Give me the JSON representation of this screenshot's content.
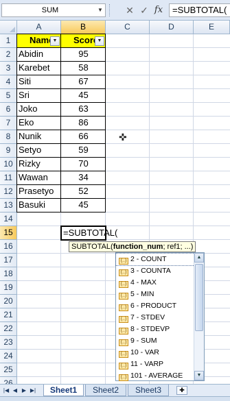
{
  "formula_bar": {
    "name_box": "SUM",
    "cancel_symbol": "✕",
    "enter_symbol": "✓",
    "fx_label": "fx",
    "formula": "=SUBTOTAL("
  },
  "columns": [
    "A",
    "B",
    "C",
    "D",
    "E"
  ],
  "rows": [
    "1",
    "2",
    "3",
    "4",
    "5",
    "6",
    "7",
    "8",
    "9",
    "10",
    "11",
    "12",
    "13",
    "14",
    "15",
    "16",
    "17",
    "18",
    "19",
    "20",
    "21",
    "22",
    "23",
    "24",
    "25",
    "26"
  ],
  "table": {
    "headers": [
      "Name",
      "Score"
    ],
    "rows": [
      [
        "Abidin",
        "95"
      ],
      [
        "Karebet",
        "58"
      ],
      [
        "Siti",
        "67"
      ],
      [
        "Sri",
        "45"
      ],
      [
        "Joko",
        "63"
      ],
      [
        "Eko",
        "86"
      ],
      [
        "Nunik",
        "66"
      ],
      [
        "Setyo",
        "59"
      ],
      [
        "Rizky",
        "70"
      ],
      [
        "Wawan",
        "34"
      ],
      [
        "Prasetyo",
        "52"
      ],
      [
        "Basuki",
        "45"
      ]
    ]
  },
  "active_cell": {
    "text": "=SUBTOTAL("
  },
  "tooltip": {
    "func": "SUBTOTAL(",
    "arg_bold": "function_num",
    "rest": "; ref1; ...)"
  },
  "autocomplete": [
    "2 - COUNT",
    "3 - COUNTA",
    "4 - MAX",
    "5 - MIN",
    "6 - PRODUCT",
    "7 - STDEV",
    "8 - STDEVP",
    "9 - SUM",
    "10 - VAR",
    "11 - VARP",
    "101 - AVERAGE"
  ],
  "sheets": [
    "Sheet1",
    "Sheet2",
    "Sheet3"
  ],
  "colors": {
    "header_fill": "#ffff00",
    "selected_header": "#f8ca5c",
    "ribbon": "#dfe8f5"
  }
}
